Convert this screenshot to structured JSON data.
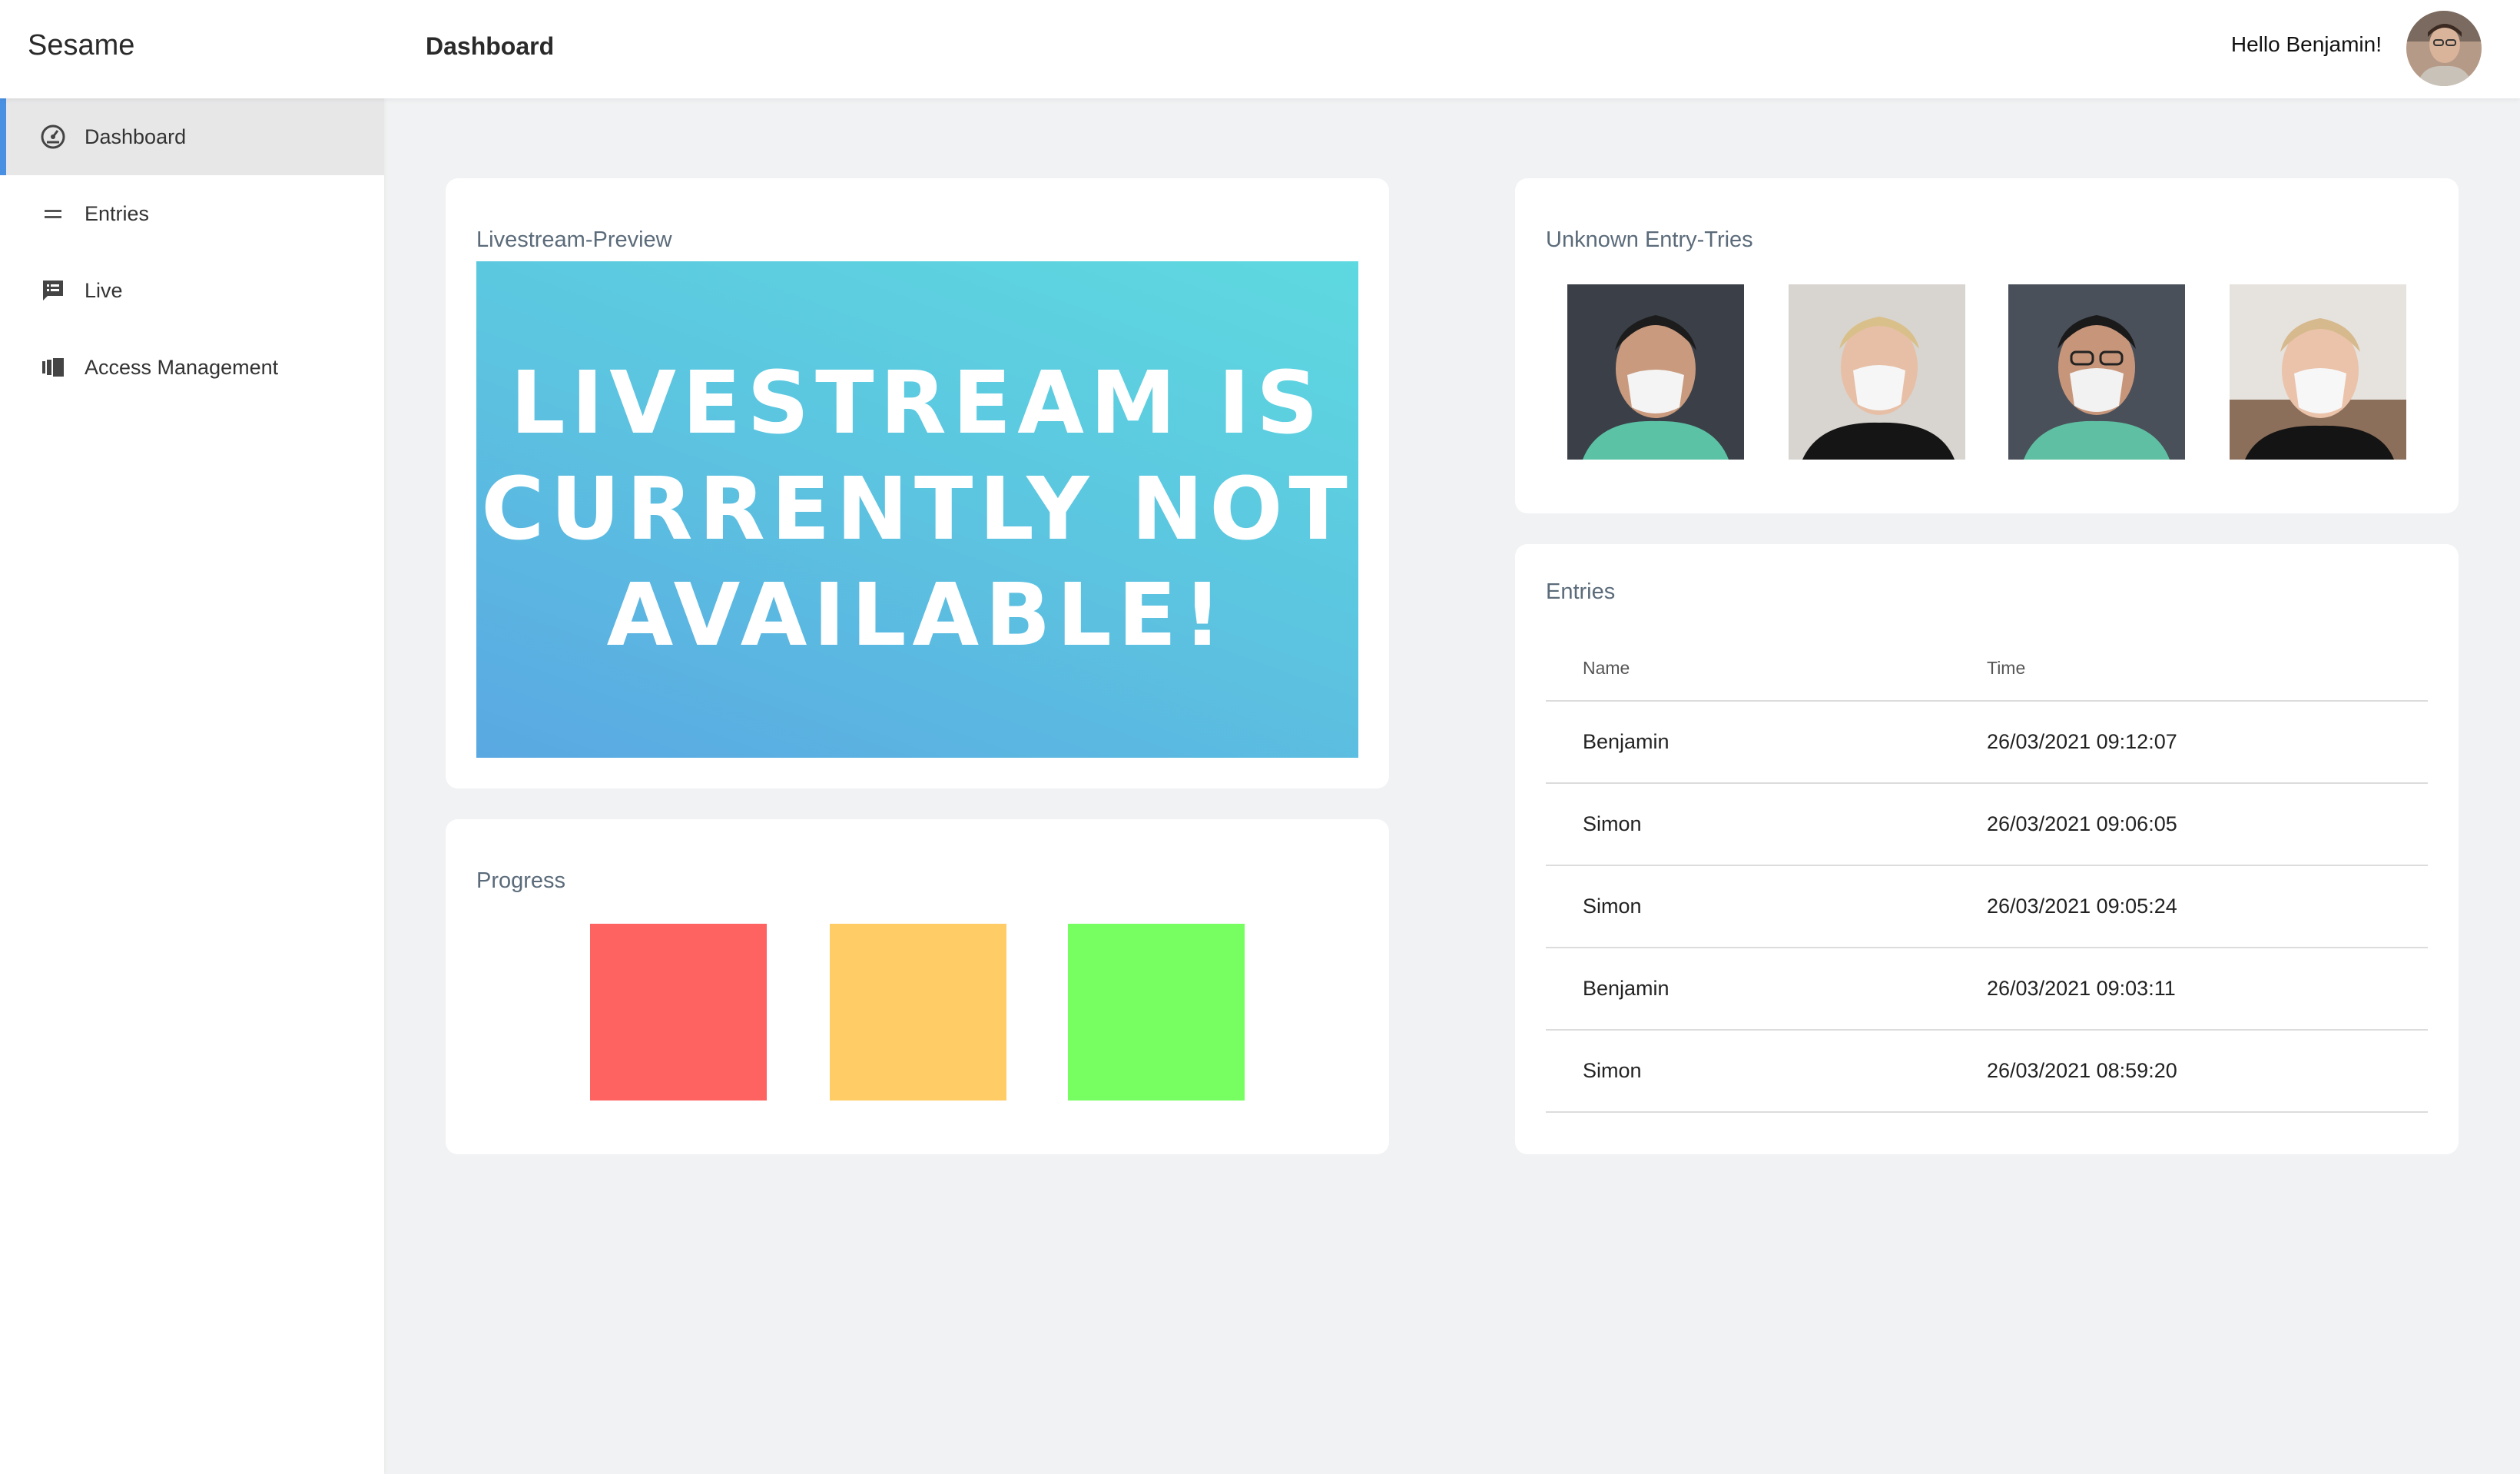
{
  "header": {
    "brand": "Sesame",
    "page_title": "Dashboard",
    "greeting": "Hello Benjamin!"
  },
  "sidebar": {
    "items": [
      {
        "label": "Dashboard",
        "icon": "dashboard-icon",
        "active": true
      },
      {
        "label": "Entries",
        "icon": "list-icon",
        "active": false
      },
      {
        "label": "Live",
        "icon": "live-icon",
        "active": false
      },
      {
        "label": "Access Management",
        "icon": "access-icon",
        "active": false
      }
    ]
  },
  "livestream": {
    "title": "Livestream-Preview",
    "message": "Livestream is currently not available!"
  },
  "progress": {
    "title": "Progress",
    "colors": [
      "#ff6361",
      "#ffcc66",
      "#77ff61"
    ]
  },
  "unknown": {
    "title": "Unknown Entry-Tries"
  },
  "entries": {
    "title": "Entries",
    "columns": [
      "Name",
      "Time"
    ],
    "rows": [
      [
        "Benjamin",
        "26/03/2021 09:12:07"
      ],
      [
        "Simon",
        "26/03/2021 09:06:05"
      ],
      [
        "Simon",
        "26/03/2021 09:05:24"
      ],
      [
        "Benjamin",
        "26/03/2021 09:03:11"
      ],
      [
        "Simon",
        "26/03/2021 08:59:20"
      ]
    ]
  },
  "colors": {
    "accent": "#4a90e2",
    "background": "#f0f2f3"
  }
}
